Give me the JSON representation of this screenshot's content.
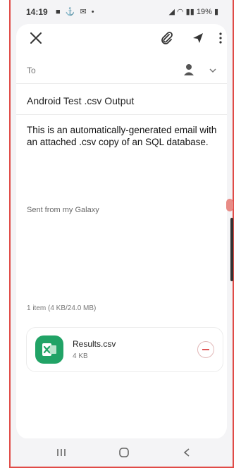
{
  "status_bar": {
    "time": "14:19",
    "notification_icons": [
      "camera-icon",
      "usb-icon",
      "mail-icon",
      "dot-icon"
    ],
    "battery": "19%"
  },
  "toolbar": {
    "close_icon": "close-icon",
    "attach_icon": "paperclip-icon",
    "send_icon": "send-icon",
    "more_icon": "more-vertical-icon"
  },
  "compose": {
    "to_label": "To",
    "subject": "Android Test .csv Output",
    "body": "This is an automatically-generated email with an attached .csv copy of an SQL database.",
    "signature": "Sent from my Galaxy"
  },
  "attachments": {
    "summary": "1 item  (4 KB/24.0 MB)",
    "items": [
      {
        "name": "Results.csv",
        "size": "4 KB",
        "icon": "excel-icon",
        "icon_color": "#21a366"
      }
    ]
  },
  "nav_bar": {
    "recent": "recent-apps-icon",
    "home": "home-icon",
    "back": "back-icon"
  },
  "colors": {
    "frame_border": "#e04b47",
    "excel_green": "#21a366",
    "remove_red": "#e05555"
  }
}
